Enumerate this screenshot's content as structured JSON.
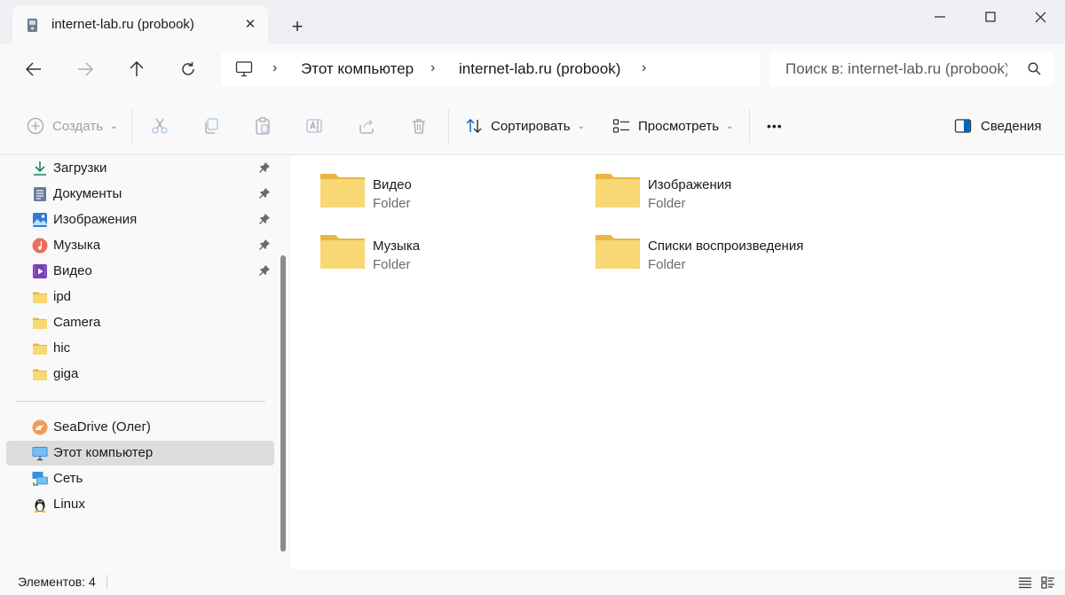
{
  "window": {
    "tab_title": "internet-lab.ru (probook)",
    "new_tab": "+"
  },
  "navigation": {
    "breadcrumbs": [
      "Этот компьютер",
      "internet-lab.ru (probook)"
    ],
    "search_placeholder": "Поиск в: internet-lab.ru (probook)"
  },
  "toolbar": {
    "create_label": "Создать",
    "sort_label": "Сортировать",
    "view_label": "Просмотреть",
    "more_label": "•••",
    "details_label": "Сведения"
  },
  "sidebar": {
    "quick_access": [
      {
        "label": "Загрузки",
        "icon": "download-icon",
        "pinned": true
      },
      {
        "label": "Документы",
        "icon": "documents-icon",
        "pinned": true
      },
      {
        "label": "Изображения",
        "icon": "pictures-icon",
        "pinned": true
      },
      {
        "label": "Музыка",
        "icon": "music-icon",
        "pinned": true
      },
      {
        "label": "Видео",
        "icon": "video-icon",
        "pinned": true
      },
      {
        "label": "ipd",
        "icon": "folder-icon",
        "pinned": false
      },
      {
        "label": "Camera",
        "icon": "folder-icon",
        "pinned": false
      },
      {
        "label": "hic",
        "icon": "folder-icon",
        "pinned": false
      },
      {
        "label": "giga",
        "icon": "folder-icon",
        "pinned": false
      }
    ],
    "locations": [
      {
        "label": "SeaDrive (Олег)",
        "icon": "seadrive-icon"
      },
      {
        "label": "Этот компьютер",
        "icon": "computer-icon",
        "selected": true
      },
      {
        "label": "Сеть",
        "icon": "network-icon"
      },
      {
        "label": "Linux",
        "icon": "linux-icon"
      }
    ]
  },
  "content": {
    "folders": [
      {
        "name": "Видео",
        "type": "Folder"
      },
      {
        "name": "Изображения",
        "type": "Folder"
      },
      {
        "name": "Музыка",
        "type": "Folder"
      },
      {
        "name": "Списки воспроизведения",
        "type": "Folder"
      }
    ]
  },
  "status": {
    "item_count": "Элементов: 4"
  },
  "colors": {
    "folder_yellow": "#f8d775",
    "folder_back": "#eab640",
    "accent_blue": "#0067c0",
    "selected_bg": "#dcdcdc"
  }
}
